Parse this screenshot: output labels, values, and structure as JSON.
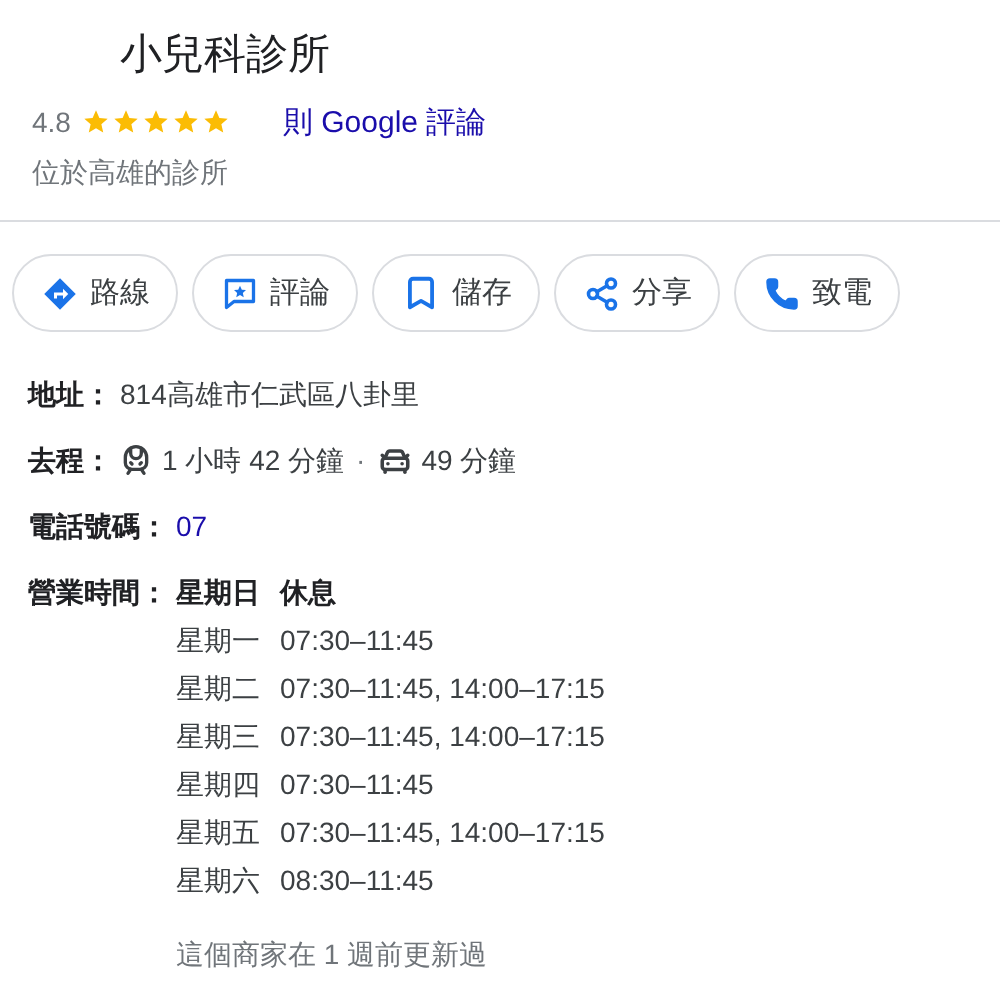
{
  "title": "小兒科診所",
  "rating": {
    "score": "4.8",
    "stars": 5,
    "reviews_link": "則 Google 評論"
  },
  "subtitle": "位於高雄的診所",
  "actions": [
    {
      "kind": "directions",
      "label": "路線"
    },
    {
      "kind": "review",
      "label": "評論"
    },
    {
      "kind": "save",
      "label": "儲存"
    },
    {
      "kind": "share",
      "label": "分享"
    },
    {
      "kind": "call",
      "label": "致電"
    }
  ],
  "address": {
    "label": "地址：",
    "value": "814高雄市仁武區八卦里"
  },
  "travel": {
    "label": "去程：",
    "modes": [
      {
        "kind": "transit",
        "time": "1 小時 42 分鐘"
      },
      {
        "kind": "car",
        "time": "49 分鐘"
      }
    ],
    "separator": "·"
  },
  "phone": {
    "label": "電話號碼：",
    "value": "07"
  },
  "hours": {
    "label": "營業時間：",
    "days": [
      {
        "day": "星期日",
        "time": "休息",
        "selected": true
      },
      {
        "day": "星期一",
        "time": "07:30–11:45",
        "selected": false
      },
      {
        "day": "星期二",
        "time": "07:30–11:45, 14:00–17:15",
        "selected": false
      },
      {
        "day": "星期三",
        "time": "07:30–11:45, 14:00–17:15",
        "selected": false
      },
      {
        "day": "星期四",
        "time": "07:30–11:45",
        "selected": false
      },
      {
        "day": "星期五",
        "time": "07:30–11:45, 14:00–17:15",
        "selected": false
      },
      {
        "day": "星期六",
        "time": "08:30–11:45",
        "selected": false
      }
    ],
    "note": "這個商家在 1 週前更新過"
  }
}
